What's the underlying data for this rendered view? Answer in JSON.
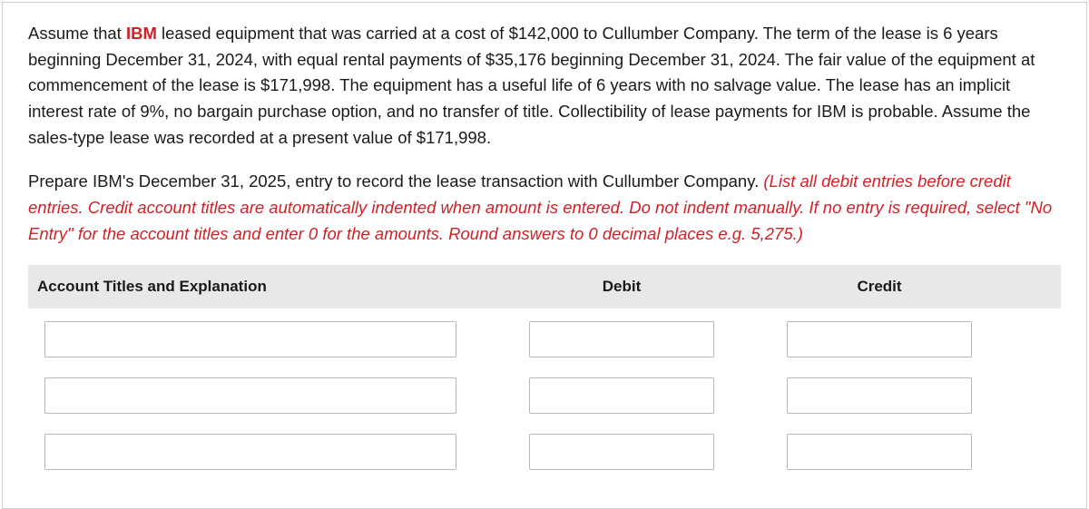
{
  "problem": {
    "intro_prefix": "Assume that ",
    "company": "IBM",
    "intro_suffix": " leased equipment that was carried at a cost of $142,000 to Cullumber Company. The term of the lease is 6 years beginning December 31, 2024, with equal rental payments of $35,176 beginning December 31, 2024. The fair value of the equipment at commencement of the lease is $171,998. The equipment has a useful life of 6 years with no salvage value. The lease has an implicit interest rate of 9%, no bargain purchase option, and no transfer of title. Collectibility of lease payments for IBM is probable. Assume the sales-type lease was recorded at a present value of $171,998.",
    "instruction_plain": "Prepare IBM's December 31, 2025, entry to record the lease transaction with Cullumber Company. ",
    "instruction_red": "(List all debit entries before credit entries. Credit account titles are automatically indented when amount is entered. Do not indent manually. If no entry is required, select \"No Entry\" for the account titles and enter 0 for the amounts. Round answers to 0 decimal places e.g. 5,275.)"
  },
  "table": {
    "headers": {
      "account": "Account Titles and Explanation",
      "debit": "Debit",
      "credit": "Credit"
    },
    "rows": [
      {
        "account": "",
        "debit": "",
        "credit": ""
      },
      {
        "account": "",
        "debit": "",
        "credit": ""
      },
      {
        "account": "",
        "debit": "",
        "credit": ""
      }
    ]
  }
}
